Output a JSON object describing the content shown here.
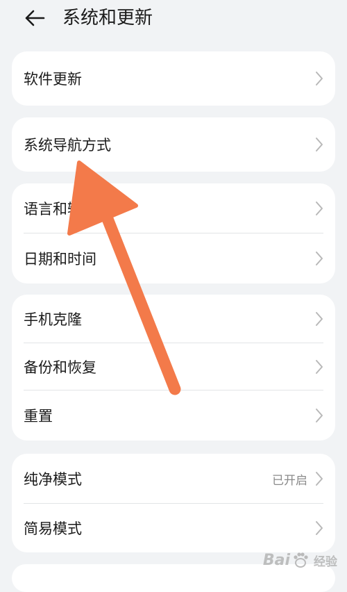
{
  "header": {
    "title": "系统和更新"
  },
  "groups": [
    {
      "items": [
        {
          "label": "软件更新",
          "value": ""
        }
      ]
    },
    {
      "items": [
        {
          "label": "系统导航方式",
          "value": ""
        }
      ]
    },
    {
      "items": [
        {
          "label": "语言和输入法",
          "value": ""
        },
        {
          "label": "日期和时间",
          "value": ""
        }
      ]
    },
    {
      "items": [
        {
          "label": "手机克隆",
          "value": ""
        },
        {
          "label": "备份和恢复",
          "value": ""
        },
        {
          "label": "重置",
          "value": ""
        }
      ]
    },
    {
      "items": [
        {
          "label": "纯净模式",
          "value": "已开启"
        },
        {
          "label": "简易模式",
          "value": ""
        }
      ]
    }
  ],
  "annotation": {
    "arrow_color": "#f37a4a"
  },
  "watermark": {
    "brand_a": "Bai",
    "brand_b": "经验"
  },
  "icons": {
    "back": "arrow-left-icon",
    "row": "chevron-right-icon",
    "watermark": "paw-icon"
  }
}
